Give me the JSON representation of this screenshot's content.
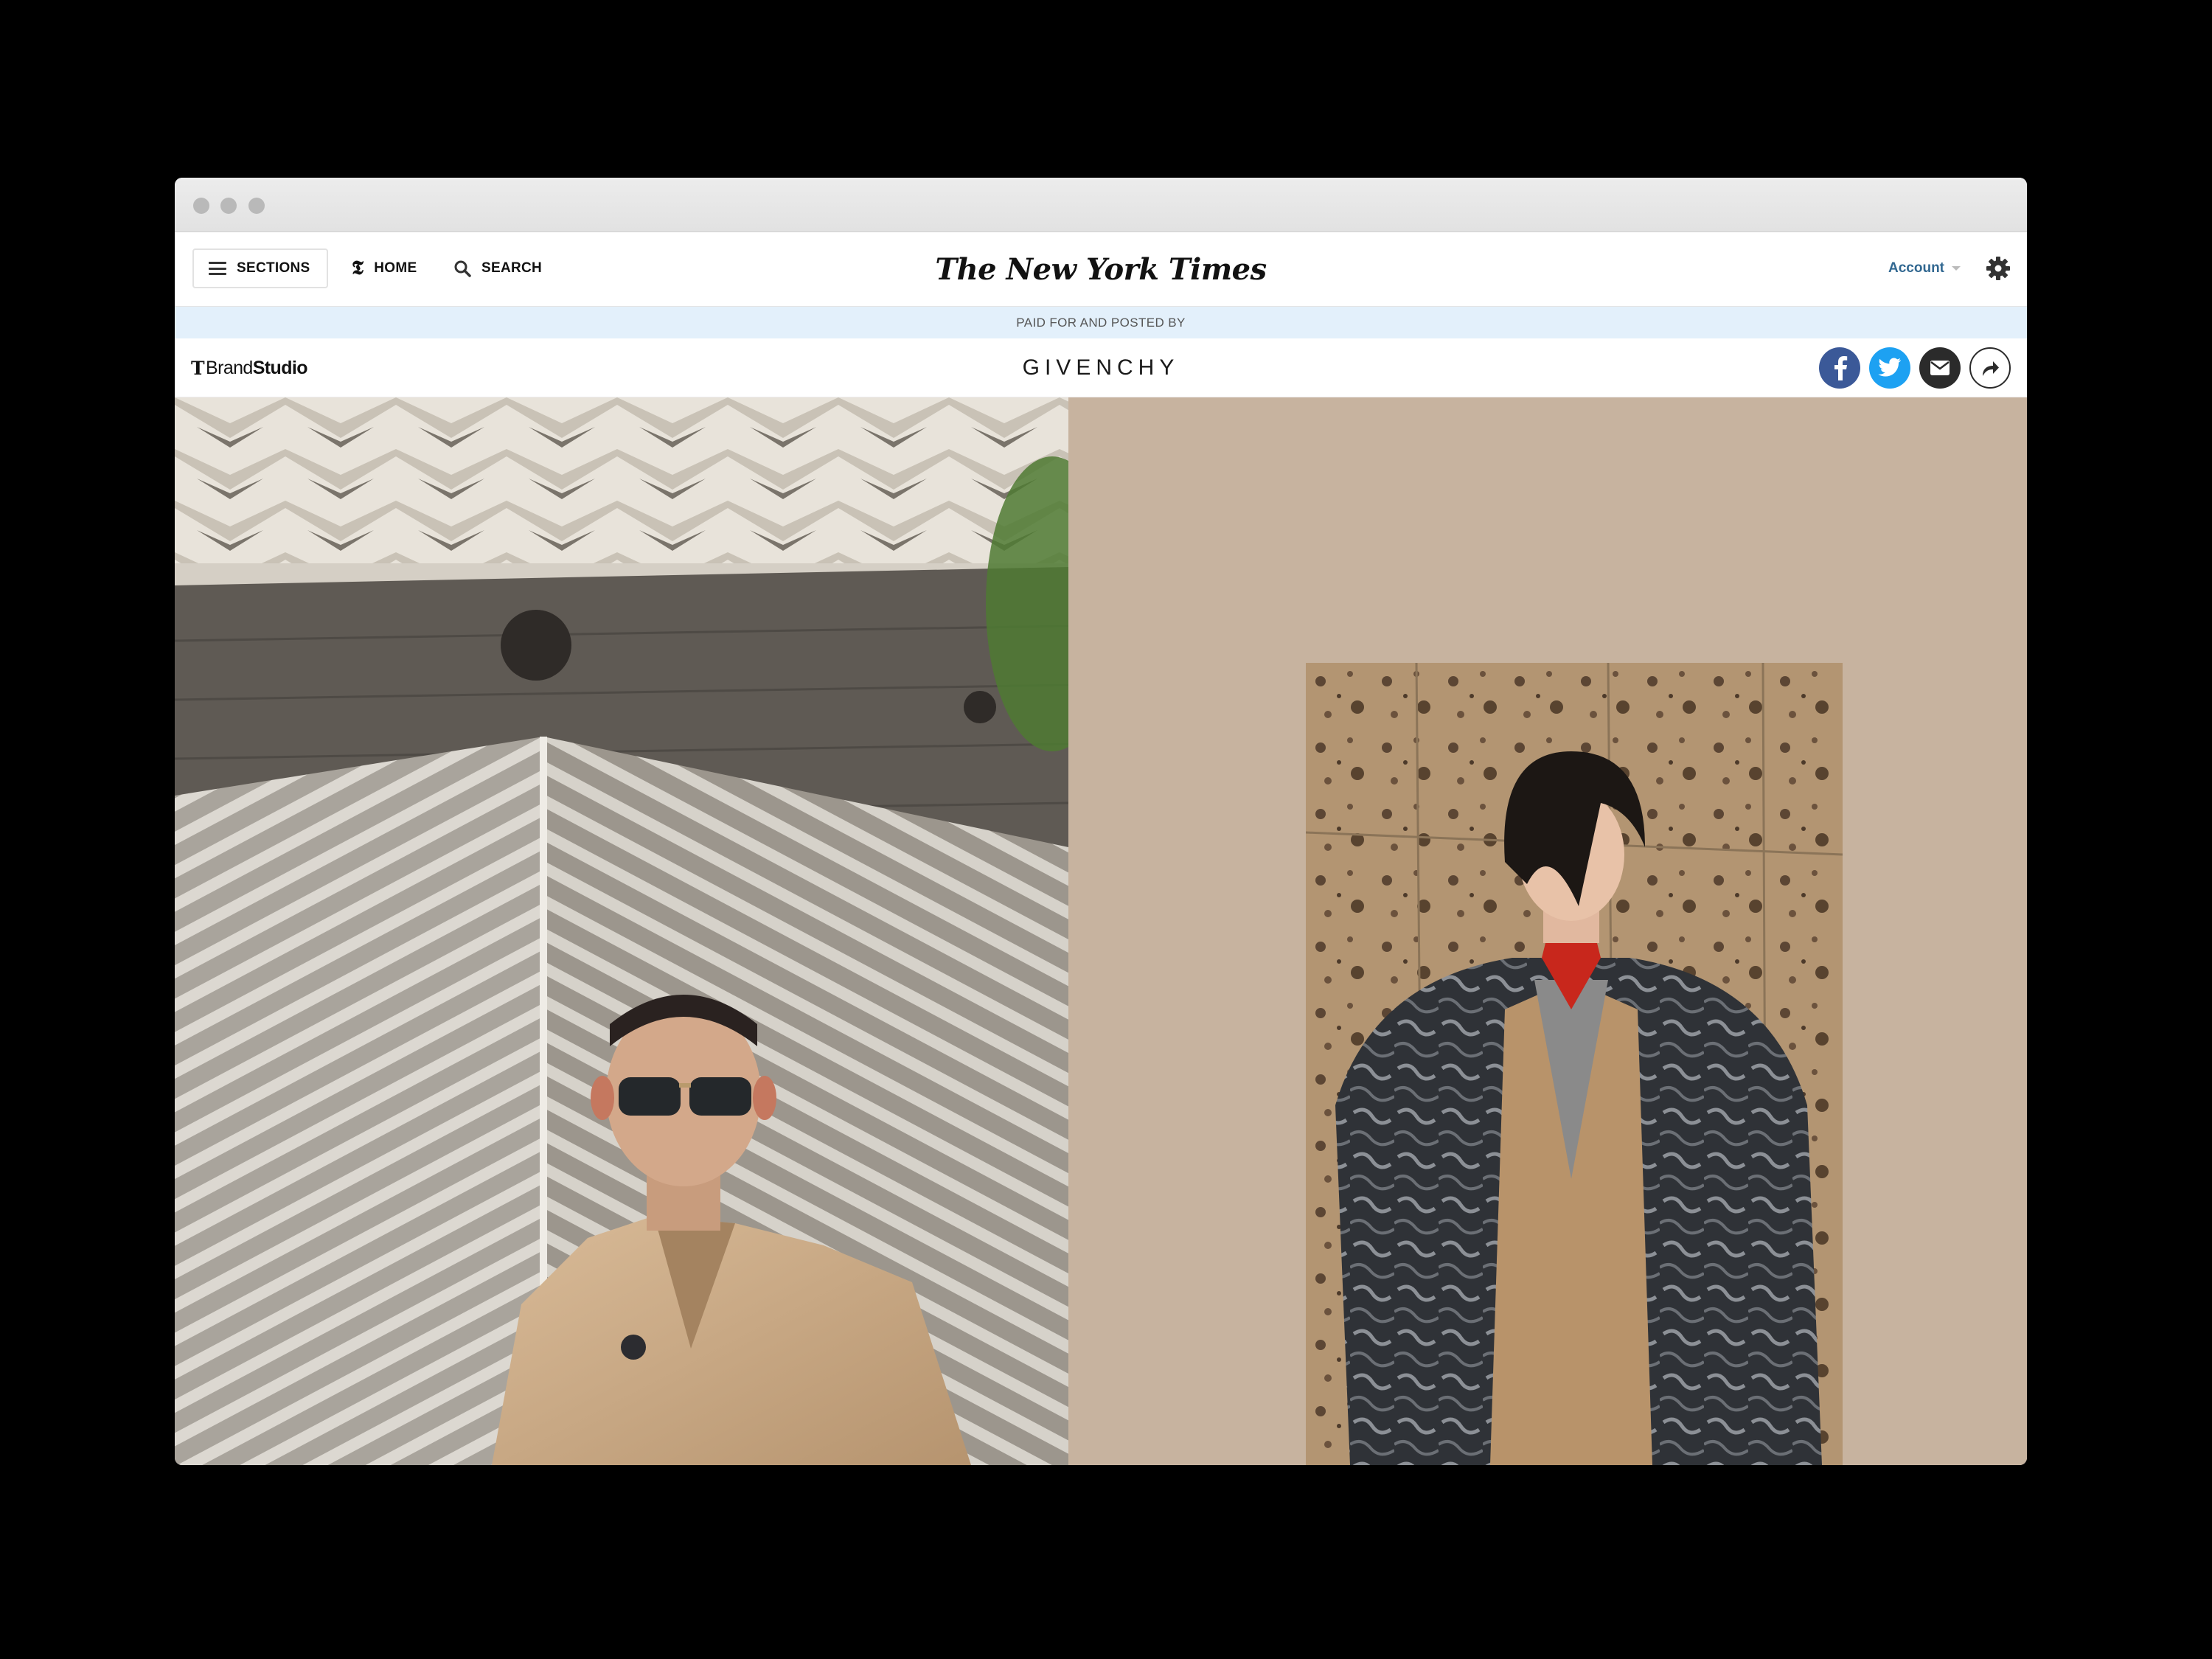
{
  "browser": {
    "controls": [
      "close",
      "minimize",
      "maximize"
    ]
  },
  "nyt_header": {
    "sections_label": "SECTIONS",
    "home_label": "HOME",
    "search_label": "SEARCH",
    "logo_text": "The New York Times",
    "account_label": "Account",
    "icons": [
      "hamburger-icon",
      "nyt-t-icon",
      "search-icon",
      "chevron-down-icon",
      "gear-icon"
    ]
  },
  "sponsor": {
    "paid_label": "PAID FOR AND POSTED BY"
  },
  "brand_bar": {
    "brandstudio_t": "T",
    "brandstudio_brand": "Brand",
    "brandstudio_studio": "Studio",
    "advertiser": "GIVENCHY",
    "share_icons": [
      "facebook-icon",
      "twitter-icon",
      "email-icon",
      "share-arrow-icon"
    ]
  },
  "colors": {
    "accent_blue": "#326891",
    "sponsor_strip": "#e3f0fb",
    "right_panel_bg": "#c7b39f",
    "facebook": "#3b5998",
    "twitter": "#1da1f2"
  },
  "images": {
    "left": "model-in-sunglasses-and-camel-coat-against-striped-building",
    "right": "model-in-fur-coat-and-red-turtleneck-against-stone-wall"
  }
}
